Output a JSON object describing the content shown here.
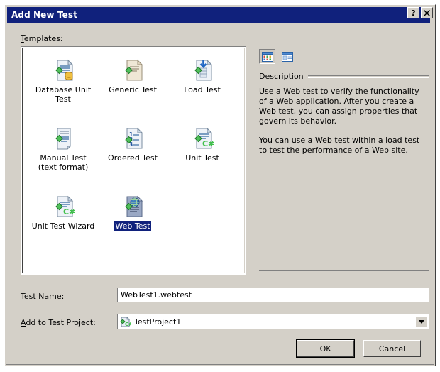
{
  "window": {
    "title": "Add New Test",
    "help_button": "?",
    "close_button": "×"
  },
  "templates_section": {
    "label_prefix": "T",
    "label_rest": "emplates:",
    "items": [
      {
        "label": "Database Unit Test",
        "icon": "database-unit-test-icon",
        "selected": false
      },
      {
        "label": "Generic Test",
        "icon": "generic-test-icon",
        "selected": false
      },
      {
        "label": "Load Test",
        "icon": "load-test-icon",
        "selected": false
      },
      {
        "label": "Manual Test (text format)",
        "icon": "manual-test-icon",
        "selected": false
      },
      {
        "label": "Ordered Test",
        "icon": "ordered-test-icon",
        "selected": false
      },
      {
        "label": "Unit Test",
        "icon": "unit-test-icon",
        "selected": false
      },
      {
        "label": "Unit Test Wizard",
        "icon": "unit-test-wizard-icon",
        "selected": false
      },
      {
        "label": "Web Test",
        "icon": "web-test-icon",
        "selected": true
      }
    ]
  },
  "view_toolbar": {
    "large_icons_label": "large-icons-view",
    "list_view_label": "list-view"
  },
  "description": {
    "title": "Description",
    "paragraph1": "Use a Web test to verify the functionality of a Web application. After you create a Web test, you can assign properties that govern its behavior.",
    "paragraph2": "You can use a Web test within a load test to test the performance of a Web site."
  },
  "test_name_field": {
    "label_before": "Test ",
    "label_accel": "N",
    "label_after": "ame:",
    "value": "WebTest1.webtest"
  },
  "project_field": {
    "label_accel": "A",
    "label_after": "dd to Test Project:",
    "value": "TestProject1",
    "icon": "csharp-project-icon"
  },
  "buttons": {
    "ok": "OK",
    "cancel": "Cancel"
  },
  "colors": {
    "dialog_face": "#d4d0c8",
    "titlebar": "#10217c",
    "selection": "#10217c",
    "list_background": "#ffffff"
  }
}
